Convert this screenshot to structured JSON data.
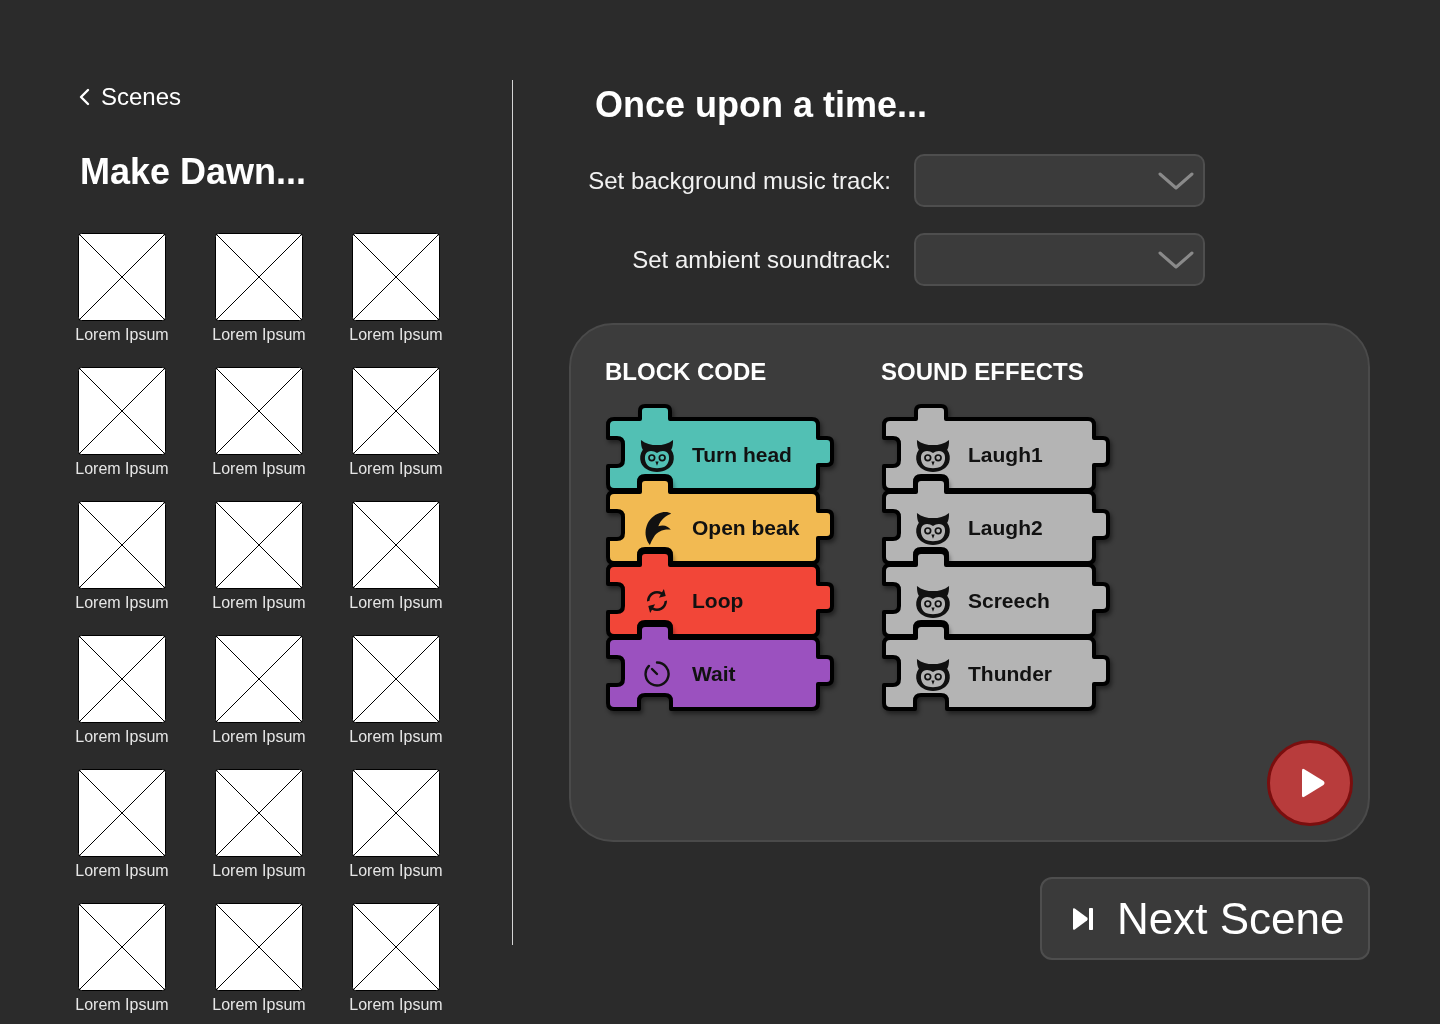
{
  "back_link": {
    "label": "Scenes"
  },
  "scene_title": "Make Dawn...",
  "scenes": [
    {
      "label": "Lorem Ipsum"
    },
    {
      "label": "Lorem Ipsum"
    },
    {
      "label": "Lorem Ipsum"
    },
    {
      "label": "Lorem Ipsum"
    },
    {
      "label": "Lorem Ipsum"
    },
    {
      "label": "Lorem Ipsum"
    },
    {
      "label": "Lorem Ipsum"
    },
    {
      "label": "Lorem Ipsum"
    },
    {
      "label": "Lorem Ipsum"
    },
    {
      "label": "Lorem Ipsum"
    },
    {
      "label": "Lorem Ipsum"
    },
    {
      "label": "Lorem Ipsum"
    },
    {
      "label": "Lorem Ipsum"
    },
    {
      "label": "Lorem Ipsum"
    },
    {
      "label": "Lorem Ipsum"
    },
    {
      "label": "Lorem Ipsum"
    },
    {
      "label": "Lorem Ipsum"
    },
    {
      "label": "Lorem Ipsum"
    }
  ],
  "story_title": "Once upon a time...",
  "settings": [
    {
      "label": "Set background music track:"
    },
    {
      "label": "Set ambient soundtrack:"
    }
  ],
  "block_code": {
    "heading": "BLOCK CODE",
    "blocks": [
      {
        "label": "Turn head",
        "kind": "head",
        "color": "#52c0b4"
      },
      {
        "label": "Open beak",
        "kind": "beak",
        "color": "#f2ba52"
      },
      {
        "label": "Loop",
        "kind": "loop",
        "color": "#f24638"
      },
      {
        "label": "Wait",
        "kind": "wait",
        "color": "#9b51bf"
      }
    ]
  },
  "sound_effects": {
    "heading": "SOUND EFFECTS",
    "blocks": [
      {
        "label": "Laugh1",
        "color": "#b4b4b4"
      },
      {
        "label": "Laugh2",
        "color": "#b4b4b4"
      },
      {
        "label": "Screech",
        "color": "#b4b4b4"
      },
      {
        "label": "Thunder",
        "color": "#b4b4b4"
      }
    ]
  },
  "next_button": {
    "label": "Next Scene"
  }
}
